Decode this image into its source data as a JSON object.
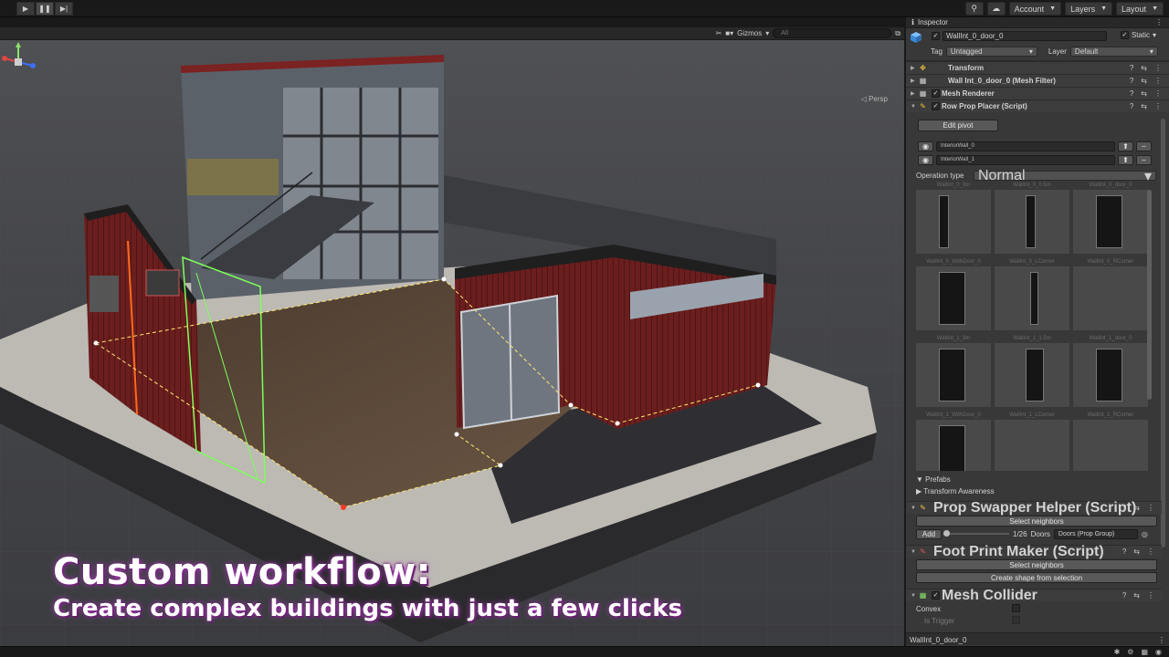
{
  "toolbar": {
    "play_icon": "play-icon",
    "pause_icon": "pause-icon",
    "step_icon": "step-icon",
    "account_label": "Account",
    "layers_label": "Layers",
    "layout_label": "Layout"
  },
  "scene_toolbar": {
    "gizmos_label": "Gizmos",
    "search_placeholder": "All",
    "persp_label": "Persp"
  },
  "overlay": {
    "headline": "Custom workflow:",
    "subline": "Create complex buildings with just a few clicks"
  },
  "inspector": {
    "tab_label": "Inspector",
    "object_name": "WallInt_0_door_0",
    "static_label": "Static",
    "tag_label": "Tag",
    "tag_value": "Untagged",
    "layer_label": "Layer",
    "layer_value": "Default",
    "components": {
      "transform": "Transform",
      "mesh_filter": "Wall Int_0_door_0 (Mesh Filter)",
      "mesh_renderer": "Mesh Renderer",
      "row_prop_placer": "Row Prop Placer (Script)"
    },
    "edit_pivot_label": "Edit pivot",
    "walls": [
      "InteriorWall_0",
      "InteriorWall_1"
    ],
    "operation_type_label": "Operation type",
    "operation_type_value": "Normal",
    "prefab_labels": [
      "WallInt_0_3m",
      "WallInt_0_0.5m",
      "WallInt_0_door_0",
      "WallInt_0_WithDoor_0",
      "WallInt_0_LCorner",
      "WallInt_0_RCorner",
      "WallInt_1_3m",
      "WallInt_1_1.5m",
      "WallInt_1_door_0",
      "WallInt_1_WithDoor_0",
      "WallInt_1_LCorner",
      "WallInt_1_RCorner"
    ],
    "prefabs_label": "Prefabs",
    "transform_awareness_label": "Transform Awareness",
    "prop_swapper": {
      "title": "Prop Swapper Helper (Script)",
      "select_neighbors": "Select neighbors",
      "add_label": "Add",
      "count": "1/26",
      "doors_label": "Doors",
      "group_value": "Doors (Prop Group)"
    },
    "footprint": {
      "title": "Foot Print Maker (Script)",
      "select_neighbors": "Select neighbors",
      "create_shape": "Create shape from selection"
    },
    "mesh_collider": {
      "title": "Mesh Collider",
      "convex_label": "Convex",
      "trigger_label": "Is Trigger"
    },
    "footer_name": "WallInt_0_door_0"
  }
}
